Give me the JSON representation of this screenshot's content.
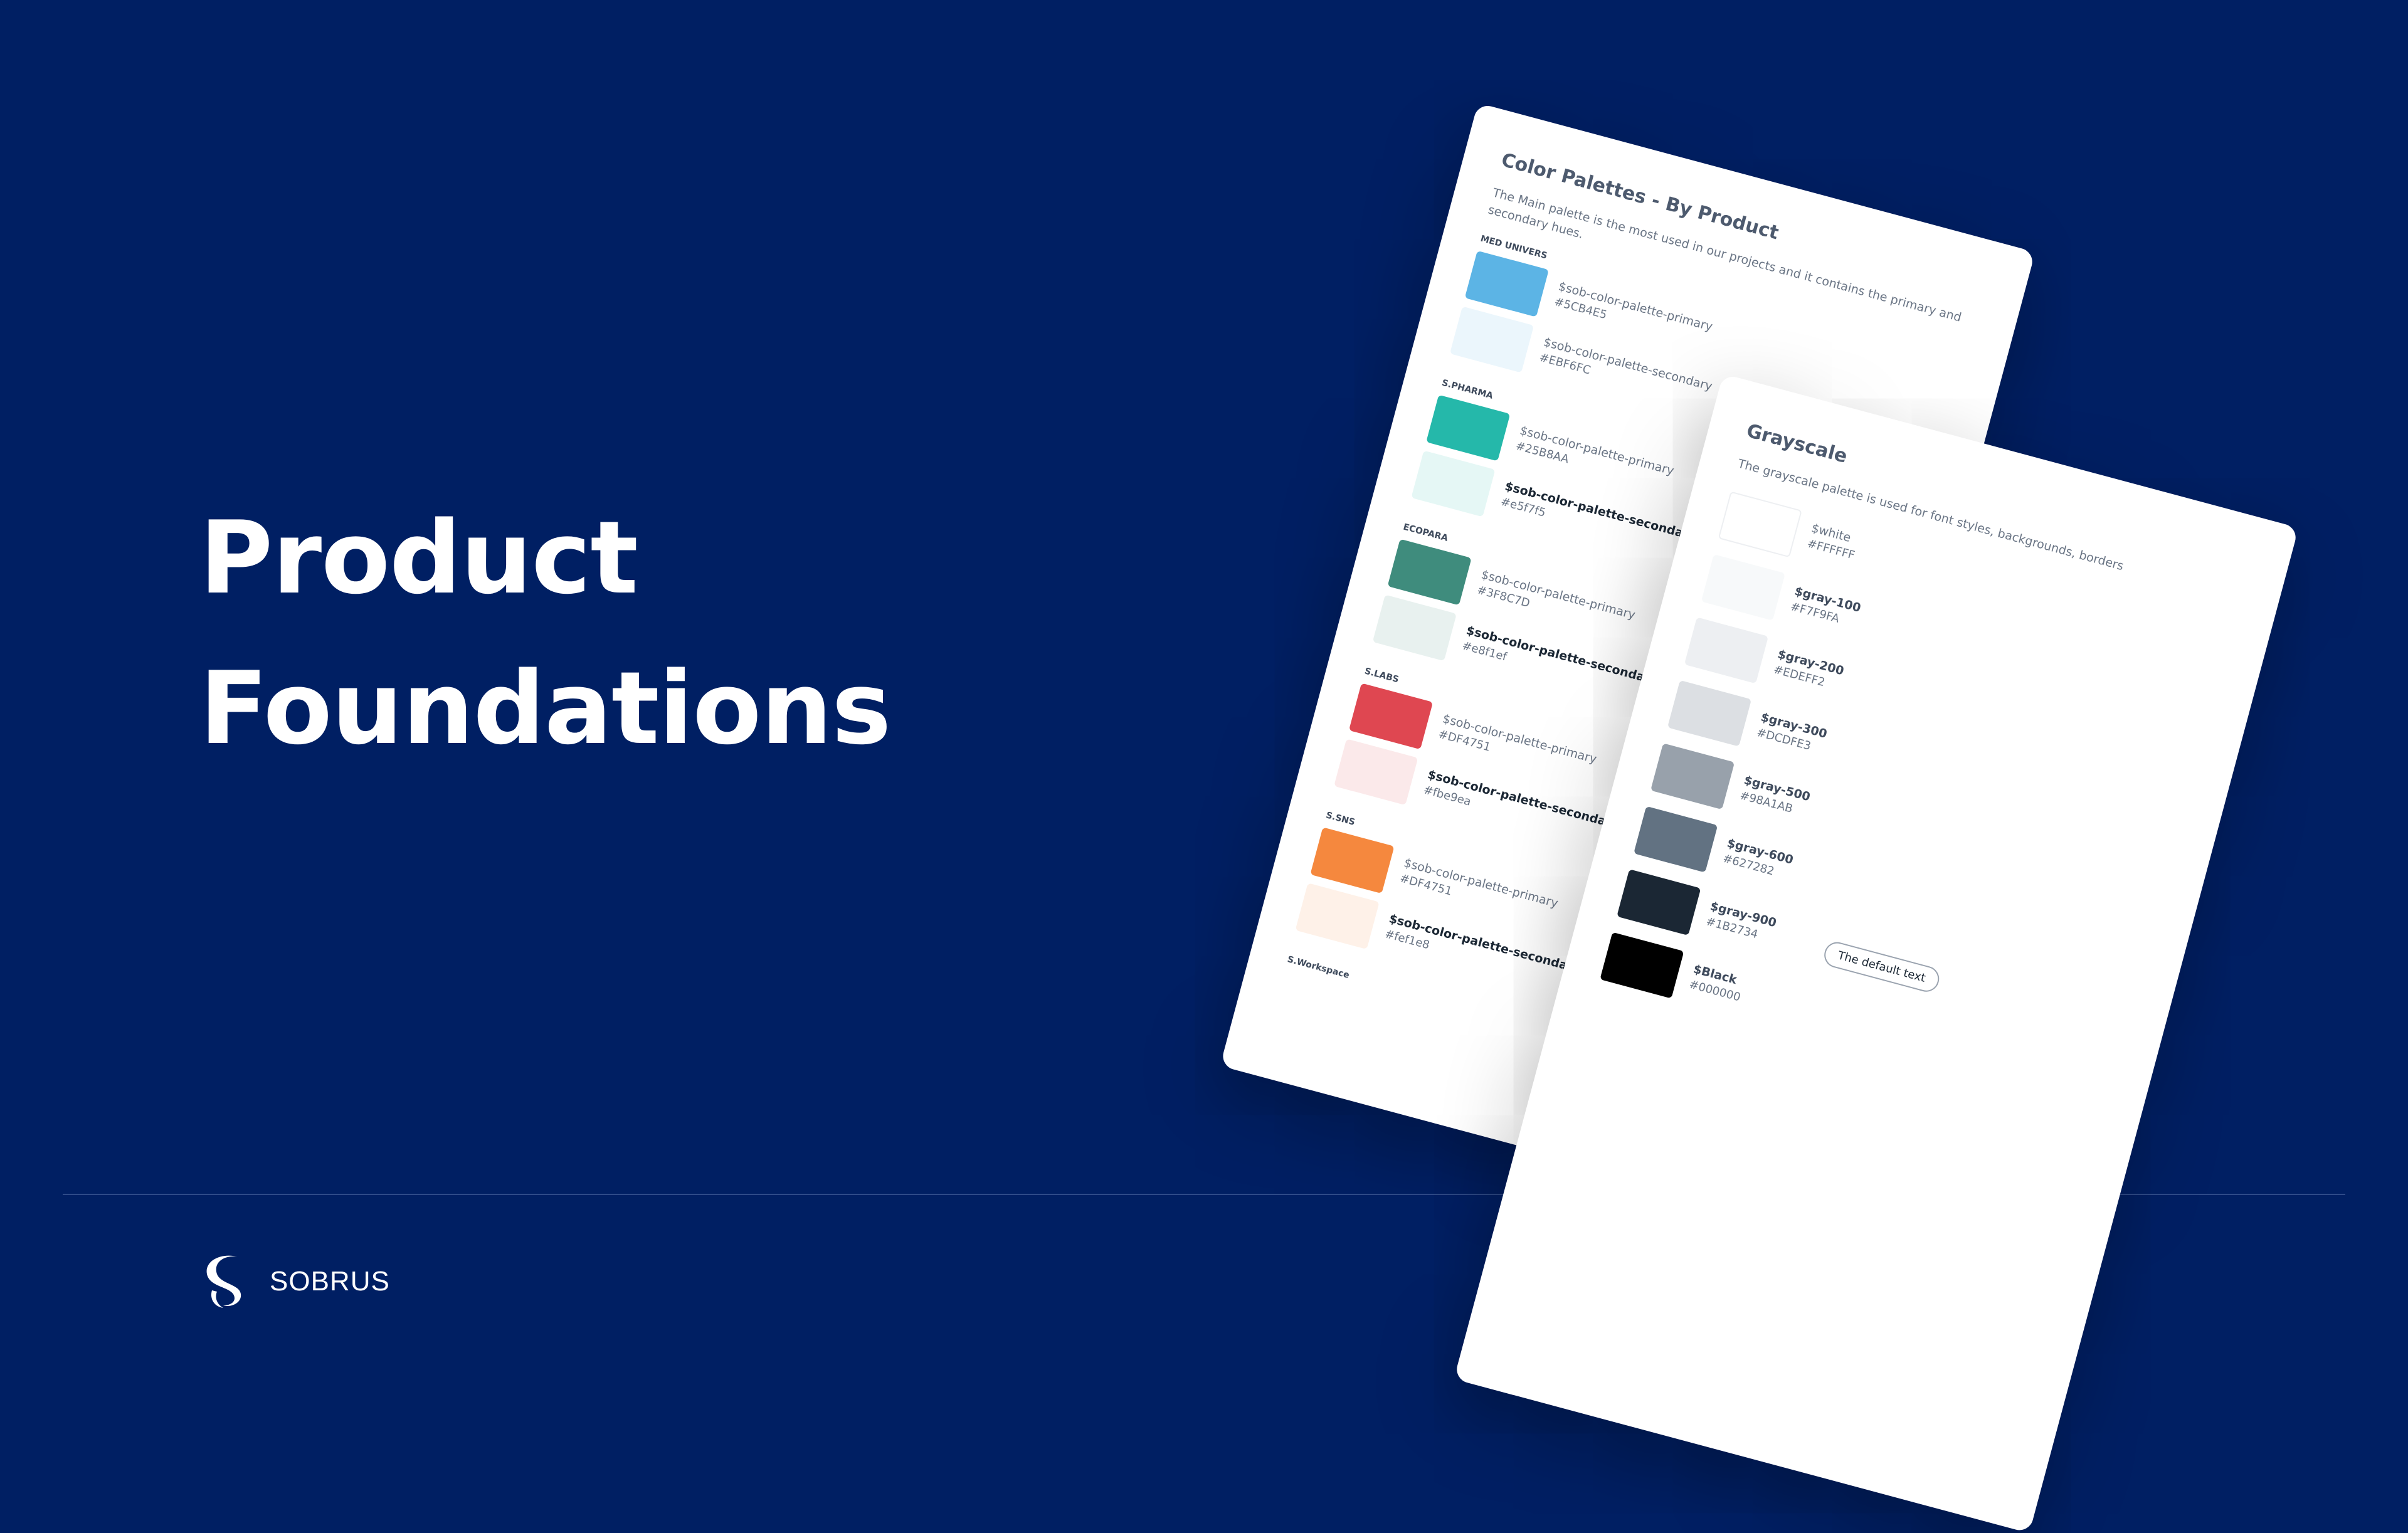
{
  "hero": {
    "line1": "Product",
    "line2": "Foundations"
  },
  "brand": {
    "name": "SOBRUS"
  },
  "palettes_card": {
    "title": "Color Palettes - By Product",
    "description": "The Main palette is the most used in our projects and it contains the primary and secondary hues.",
    "groups": [
      {
        "label": "MED UNIVERS",
        "swatches": [
          {
            "token": "$sob-color-palette-primary",
            "hex": "#5CB4E5",
            "color": "#5CB4E5"
          },
          {
            "token": "$sob-color-palette-secondary",
            "hex": "#EBF6FC",
            "color": "#EBF6FC"
          }
        ]
      },
      {
        "label": "S.PHARMA",
        "swatches": [
          {
            "token": "$sob-color-palette-primary",
            "hex": "#25B8AA",
            "color": "#25B8AA"
          },
          {
            "token": "$sob-color-palette-secondary",
            "hex": "#e5f7f5",
            "color": "#E5F7F5"
          }
        ]
      },
      {
        "label": "ECOPARA",
        "swatches": [
          {
            "token": "$sob-color-palette-primary",
            "hex": "#3F8C7D",
            "color": "#3F8C7D"
          },
          {
            "token": "$sob-color-palette-secondary",
            "hex": "#e8f1ef",
            "color": "#E8F1EF"
          }
        ]
      },
      {
        "label": "S.LABS",
        "swatches": [
          {
            "token": "$sob-color-palette-primary",
            "hex": "#DF4751",
            "color": "#DF4751"
          },
          {
            "token": "$sob-color-palette-secondary",
            "hex": "#fbe9ea",
            "color": "#FBE9EA"
          }
        ]
      },
      {
        "label": "S.SNS",
        "swatches": [
          {
            "token": "$sob-color-palette-primary",
            "hex": "#DF4751",
            "color": "#F5883E"
          },
          {
            "token": "$sob-color-palette-secondary",
            "hex": "#fef1e8",
            "color": "#FEF1E8"
          }
        ]
      }
    ],
    "trailing_label": "S.Workspace"
  },
  "grayscale_card": {
    "title": "Grayscale",
    "description": "The grayscale palette is used for font styles, backgrounds, borders",
    "swatches": [
      {
        "token": "$white",
        "hex": "#FFFFFF",
        "color": "#FFFFFF"
      },
      {
        "token": "$gray-100",
        "hex": "#F7F9FA",
        "color": "#F7F9FA"
      },
      {
        "token": "$gray-200",
        "hex": "#EDEFF2",
        "color": "#EDEFF2"
      },
      {
        "token": "$gray-300",
        "hex": "#DCDFE3",
        "color": "#DCDFE3"
      },
      {
        "token": "$gray-500",
        "hex": "#98A1AB",
        "color": "#98A1AB"
      },
      {
        "token": "$gray-600",
        "hex": "#627282",
        "color": "#627282"
      },
      {
        "token": "$gray-900",
        "hex": "#1B2734",
        "color": "#1B2734"
      },
      {
        "token": "$Black",
        "hex": "#000000",
        "color": "#000000"
      }
    ],
    "default_text_badge": "The default text"
  },
  "colors": {
    "background": "#001F63",
    "card": "#FFFFFF",
    "divider": "#2E4A88"
  }
}
